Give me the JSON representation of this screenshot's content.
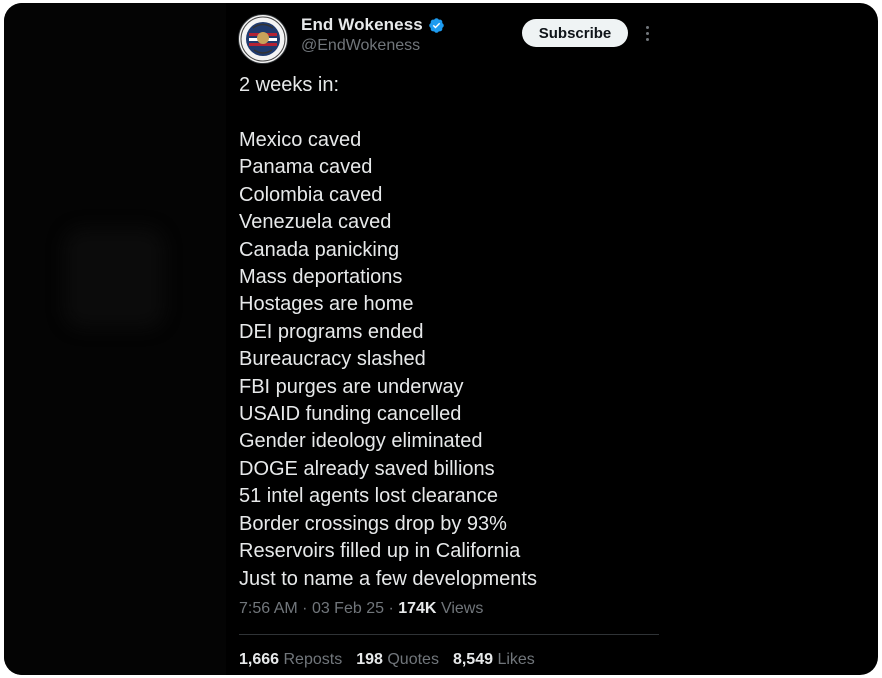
{
  "profile": {
    "display_name": "End Wokeness",
    "handle": "@EndWokeness",
    "verified_icon": "verified-badge-icon",
    "avatar_icon": "profile-avatar",
    "colors": {
      "verified": "#1d9bf0"
    }
  },
  "actions": {
    "subscribe_label": "Subscribe",
    "more_icon": "more-options-icon"
  },
  "tweet": {
    "intro": "2 weeks in:",
    "lines": [
      "Mexico caved",
      "Panama caved",
      "Colombia caved",
      "Venezuela caved",
      "Canada panicking",
      "Mass deportations",
      "Hostages are home",
      "DEI programs ended",
      "Bureaucracy slashed",
      "FBI purges are underway",
      "USAID funding cancelled",
      "Gender ideology eliminated",
      "DOGE already saved billions",
      "51 intel agents lost clearance",
      "Border crossings drop by 93%",
      "Reservoirs filled up in California",
      "Just to name a few developments"
    ]
  },
  "meta": {
    "time": "7:56 AM",
    "date": "03 Feb 25",
    "views_count": "174K",
    "views_label": "Views",
    "separator": "·"
  },
  "stats": {
    "reposts_count": "1,666",
    "reposts_label": "Reposts",
    "quotes_count": "198",
    "quotes_label": "Quotes",
    "likes_count": "8,549",
    "likes_label": "Likes"
  },
  "colors": {
    "background": "#000000",
    "text": "#e7e9ea",
    "muted": "#71767b",
    "button_bg": "#eff3f4"
  }
}
